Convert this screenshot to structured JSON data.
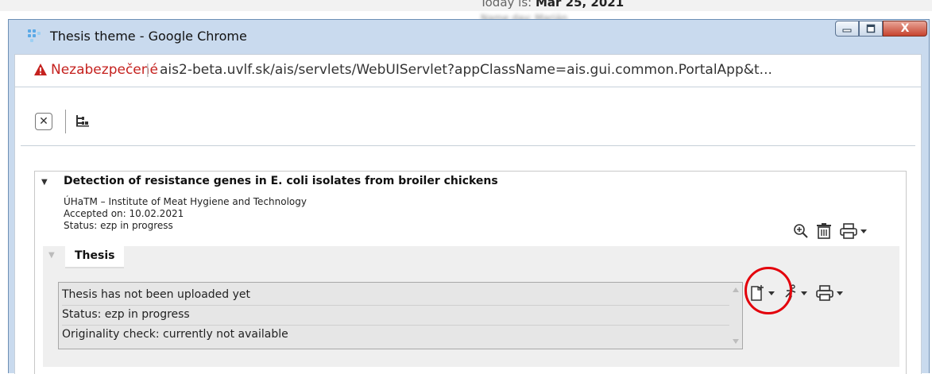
{
  "background": {
    "today_label": "Today is: ",
    "today_date": "Mar 25, 2021",
    "nameday_label": "Name day: Marián"
  },
  "window": {
    "title": "Thesis theme - Google Chrome",
    "close_glyph": "X"
  },
  "address_bar": {
    "security_label": "Nezabezpečené",
    "separator": "|",
    "url": "ais2-beta.uvlf.sk/ais/servlets/WebUIServlet?appClassName=ais.gui.common.PortalApp&t..."
  },
  "toolbar": {
    "close_glyph": "✕"
  },
  "thesis_panel": {
    "title": "Detection of resistance genes in E. coli isolates from broiler chickens",
    "department": "ÚHaTM – Institute of Meat Hygiene and Technology",
    "accepted": "Accepted on: 10.02.2021",
    "status": "Status: ezp in progress"
  },
  "thesis_subpanel": {
    "tab_label": "Thesis",
    "lines": [
      "Thesis has not been uploaded yet",
      "Status: ezp in progress",
      "Originality check: currently not available"
    ]
  },
  "icons": [
    "zoom-in-icon",
    "trash-icon",
    "print-icon",
    "add-document-icon",
    "runner-icon",
    "print-icon"
  ],
  "colors": {
    "warning_red": "#c5221f",
    "highlight_circle": "#e3000b",
    "window_frame": "#c9daee"
  }
}
